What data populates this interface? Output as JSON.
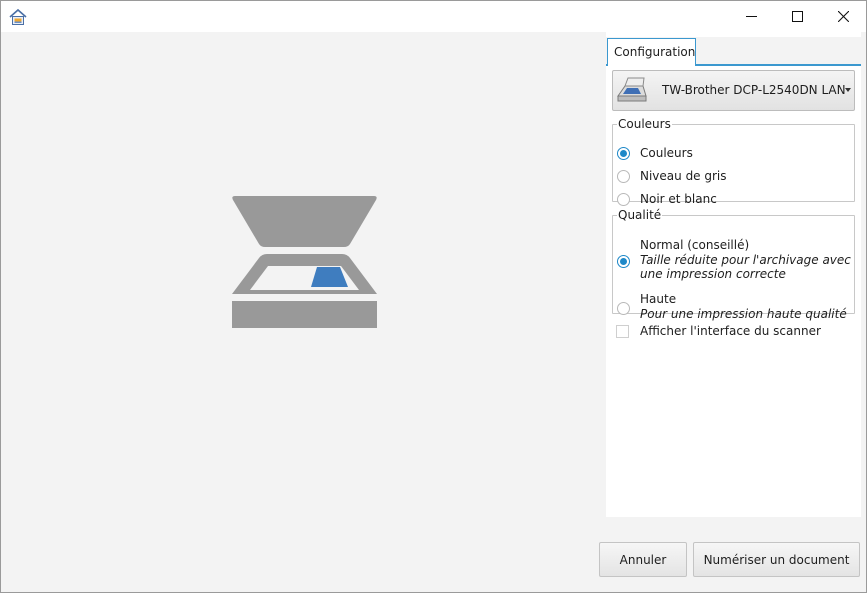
{
  "window": {
    "app_icon": "home-scanner-icon",
    "controls": [
      "minimize-icon",
      "maximize-icon",
      "close-icon"
    ]
  },
  "preview": {
    "illustration": "scanner-icon",
    "colors": {
      "gray": "#999999",
      "accent": "#3f7dbf"
    }
  },
  "panel": {
    "tab_label": "Configuration",
    "device": {
      "name": "TW-Brother DCP-L2540DN LAN",
      "icon": "scanner-device-icon"
    },
    "colors_group": {
      "legend": "Couleurs",
      "options": [
        {
          "label": "Couleurs",
          "checked": true
        },
        {
          "label": "Niveau de gris",
          "checked": false
        },
        {
          "label": "Noir et blanc",
          "checked": false
        }
      ]
    },
    "quality_group": {
      "legend": "Qualité",
      "options": [
        {
          "label": "Normal (conseillé)",
          "desc1": "Taille réduite pour l'archivage avec",
          "desc2": "une impression correcte",
          "checked": true
        },
        {
          "label": "Haute",
          "desc1": "Pour une impression haute qualité",
          "checked": false
        }
      ]
    },
    "show_scanner_ui": {
      "label": "Afficher l'interface du scanner",
      "checked": false
    }
  },
  "actions": {
    "cancel_label": "Annuler",
    "scan_label": "Numériser un document"
  },
  "theme": {
    "accent": "#3b98cf",
    "radio_accent": "#1e88c8"
  }
}
